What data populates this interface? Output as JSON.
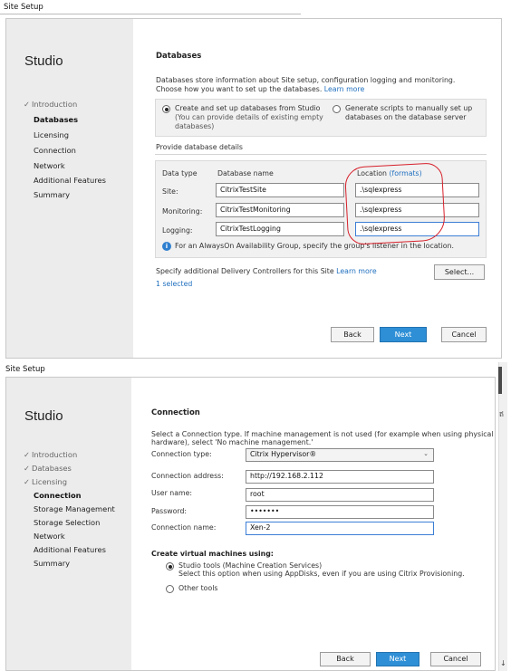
{
  "top": {
    "title": "Site Setup",
    "studio": "Studio",
    "nav": [
      {
        "label": "Introduction",
        "state": "done"
      },
      {
        "label": "Databases",
        "state": "active"
      },
      {
        "label": "Licensing",
        "state": "todo"
      },
      {
        "label": "Connection",
        "state": "todo"
      },
      {
        "label": "Network",
        "state": "todo"
      },
      {
        "label": "Additional Features",
        "state": "todo"
      },
      {
        "label": "Summary",
        "state": "todo"
      }
    ],
    "heading": "Databases",
    "intro_line1": "Databases store information about Site setup, configuration logging and monitoring.",
    "intro_line2": "Choose how you want to set up the databases.",
    "learn_more": "Learn more",
    "option1_title": "Create and set up databases from Studio",
    "option1_sub1": "(You can provide details of existing empty",
    "option1_sub2": "databases)",
    "option2_line1": "Generate scripts to manually set up",
    "option2_line2": "databases on the database server",
    "provide": "Provide database details",
    "col_type": "Data type",
    "col_name": "Database name",
    "col_location": "Location",
    "formats": "(formats)",
    "rows": [
      {
        "type": "Site:",
        "name": "CitrixTestSite",
        "location": ".\\sqlexpress"
      },
      {
        "type": "Monitoring:",
        "name": "CitrixTestMonitoring",
        "location": ".\\sqlexpress"
      },
      {
        "type": "Logging:",
        "name": "CitrixTestLogging",
        "location": ".\\sqlexpress"
      }
    ],
    "info": "For an AlwaysOn Availability Group, specify the group's listener in the location.",
    "controllers": "Specify additional Delivery Controllers for this Site",
    "controllers_link": "Learn more",
    "select": "Select...",
    "selected": "1 selected",
    "back": "Back",
    "next": "Next",
    "cancel": "Cancel"
  },
  "bottom": {
    "title": "Site Setup",
    "studio": "Studio",
    "nav": [
      {
        "label": "Introduction",
        "state": "done"
      },
      {
        "label": "Databases",
        "state": "done"
      },
      {
        "label": "Licensing",
        "state": "done"
      },
      {
        "label": "Connection",
        "state": "active"
      },
      {
        "label": "Storage Management",
        "state": "todo"
      },
      {
        "label": "Storage Selection",
        "state": "todo"
      },
      {
        "label": "Network",
        "state": "todo"
      },
      {
        "label": "Additional Features",
        "state": "todo"
      },
      {
        "label": "Summary",
        "state": "todo"
      }
    ],
    "heading": "Connection",
    "intro_line1": "Select a Connection type. If machine management is not used (for example when using physical",
    "intro_line2": "hardware), select 'No machine management.'",
    "fields": [
      {
        "label": "Connection type:",
        "value": "Citrix Hypervisor®"
      },
      {
        "label": "Connection address:",
        "value": "http://192.168.2.112"
      },
      {
        "label": "User name:",
        "value": "root"
      },
      {
        "label": "Password:",
        "value": "•••••••"
      },
      {
        "label": "Connection name:",
        "value": "Xen-2"
      }
    ],
    "create_heading": "Create virtual machines using:",
    "opt1_title": "Studio tools (Machine Creation Services)",
    "opt1_sub": "Select this option when using AppDisks, even if you are using Citrix Provisioning.",
    "opt2_title": "Other tools",
    "back": "Back",
    "next": "Next",
    "cancel": "Cancel",
    "side_glyph": "ឥ"
  }
}
